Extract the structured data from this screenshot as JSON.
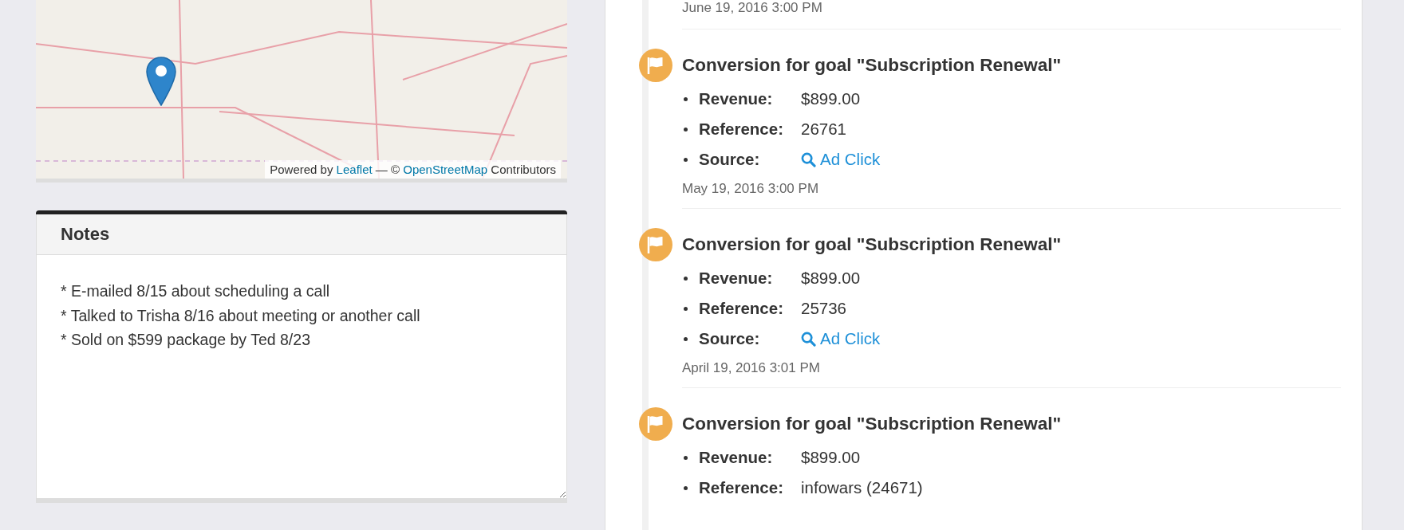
{
  "map": {
    "attribution": {
      "prefix": "Powered by",
      "first_link": "Leaflet",
      "separator": "— ©",
      "second_link": "OpenStreetMap",
      "suffix": "Contributors"
    }
  },
  "notes": {
    "title": "Notes",
    "lines": [
      "* E-mailed 8/15 about scheduling a call",
      "* Talked to Trisha 8/16 about meeting or another call",
      "* Sold on $599 package by Ted 8/23"
    ]
  },
  "timeline": {
    "top_timestamp": "June 19, 2016 3:00 PM",
    "events": [
      {
        "title": "Conversion for goal \"Subscription Renewal\"",
        "fields": [
          {
            "label": "Revenue:",
            "value": "$899.00",
            "kind": "text"
          },
          {
            "label": "Reference:",
            "value": "26761",
            "kind": "text"
          },
          {
            "label": "Source:",
            "value": "Ad Click",
            "kind": "link"
          }
        ],
        "timestamp": "May 19, 2016 3:00 PM"
      },
      {
        "title": "Conversion for goal \"Subscription Renewal\"",
        "fields": [
          {
            "label": "Revenue:",
            "value": "$899.00",
            "kind": "text"
          },
          {
            "label": "Reference:",
            "value": "25736",
            "kind": "text"
          },
          {
            "label": "Source:",
            "value": "Ad Click",
            "kind": "link"
          }
        ],
        "timestamp": "April 19, 2016 3:01 PM"
      },
      {
        "title": "Conversion for goal \"Subscription Renewal\"",
        "fields": [
          {
            "label": "Revenue:",
            "value": "$899.00",
            "kind": "text"
          },
          {
            "label": "Reference:",
            "value": "infowars (24671)",
            "kind": "text"
          }
        ]
      }
    ]
  }
}
